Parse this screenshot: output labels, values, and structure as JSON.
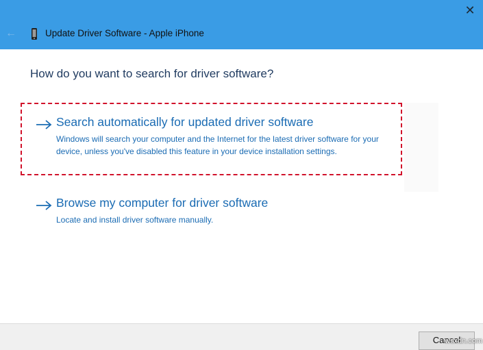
{
  "window": {
    "title": "Update Driver Software - Apple iPhone",
    "close_glyph": "✕",
    "back_glyph": "←"
  },
  "main": {
    "heading": "How do you want to search for driver software?",
    "options": [
      {
        "title": "Search automatically for updated driver software",
        "description": "Windows will search your computer and the Internet for the latest driver software for your device, unless you've disabled this feature in your device installation settings.",
        "highlighted": true
      },
      {
        "title": "Browse my computer for driver software",
        "description": "Locate and install driver software manually.",
        "highlighted": false
      }
    ]
  },
  "footer": {
    "cancel_label": "Cancel"
  },
  "watermark": "wsxdn.com",
  "colors": {
    "titlebar": "#3a9ce5",
    "link": "#1a6bb3",
    "highlight_border": "#d1122b"
  },
  "icons": {
    "device": "phone-icon",
    "option_arrow": "right-arrow-icon",
    "back": "back-arrow-icon",
    "close": "close-icon"
  }
}
